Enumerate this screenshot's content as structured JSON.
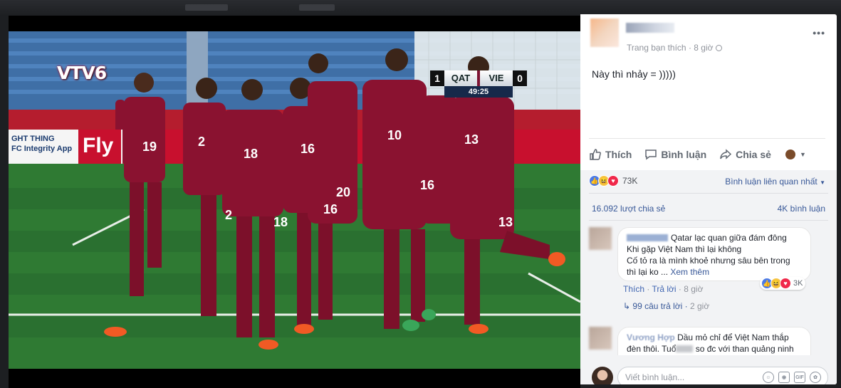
{
  "video": {
    "broadcaster_logo": "VTV6",
    "scoreboard": {
      "home_team": "QAT",
      "home_score": "1",
      "away_team": "VIE",
      "away_score": "0",
      "clock": "49:25"
    },
    "ad_board_text": "GHT THING\nFC Integrity App",
    "ad_board_brand": "Fly",
    "jersey_numbers": [
      "19",
      "2",
      "18",
      "16",
      "10",
      "13",
      "20",
      "16",
      "18",
      "13",
      "2",
      "16"
    ]
  },
  "post": {
    "meta": "Trang bạn thích · 8 giờ",
    "text": "Này thì nhảy = )))))",
    "actions": {
      "like": "Thích",
      "comment": "Bình luận",
      "share": "Chia sẻ"
    },
    "reactions_count": "73K",
    "sort_label": "Bình luận liên quan nhất",
    "shares_label": "16.092 lượt chia sẻ",
    "comments_label": "4K bình luận"
  },
  "comments": [
    {
      "text_line1": "Qatar lạc quan giữa đám đông",
      "text_line2": "Khi gặp Việt Nam thì lại không",
      "text_line3": "Cố tỏ ra là mình khoẻ nhưng sâu bên trong",
      "text_line4": "thì lại ko ...",
      "see_more": "Xem thêm",
      "like_label": "Thích",
      "reply_label": "Trả lời",
      "time": "8 giờ",
      "reaction_count": "3K",
      "replies_label": "99 câu trả lời",
      "replies_time": "2 giờ"
    },
    {
      "author": "Vương Hợp",
      "text_line1": "Dầu mỏ chỉ để Việt Nam thắp",
      "text_line2_a": "đèn thôi. Tuổ",
      "text_line2_b": "so đc với than quảng ninh"
    }
  ],
  "composer": {
    "placeholder": "Viết bình luận...",
    "tools": [
      "emoji-icon",
      "camera-icon",
      "gif-icon",
      "sticker-icon"
    ]
  }
}
